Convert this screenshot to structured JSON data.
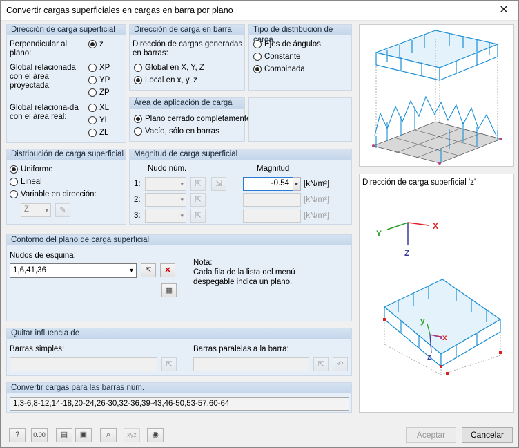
{
  "window": {
    "title": "Convertir cargas superficiales en cargas en barra por plano",
    "close": "✕"
  },
  "dir_surface": {
    "header": "Dirección de carga superficial",
    "perp_label": "Perpendicular al plano:",
    "global_proj_label": "Global relacionada con el área proyectada:",
    "global_real_label": "Global relaciona-da con el área real:",
    "opts": {
      "z": "z",
      "xp": "XP",
      "yp": "YP",
      "zp": "ZP",
      "xl": "XL",
      "yl": "YL",
      "zl": "ZL"
    },
    "selected": "z"
  },
  "dir_bar": {
    "header": "Dirección de carga en barra",
    "desc": "Dirección de cargas generadas en barras:",
    "global": "Global en X, Y, Z",
    "local": "Local en x, y, z",
    "selected": "local"
  },
  "dist_type": {
    "header": "Tipo de distribución de carga",
    "ejes": "Ejes de ángulos",
    "constante": "Constante",
    "combinada": "Combinada",
    "selected": "combinada"
  },
  "area": {
    "header": "Área de aplicación de carga",
    "cerrado": "Plano cerrado completamente",
    "vacio": "Vacío, sólo en barras",
    "selected": "cerrado"
  },
  "dist_surface": {
    "header": "Distribución de carga superficial",
    "uniforme": "Uniforme",
    "lineal": "Lineal",
    "variable": "Variable en dirección:",
    "dir_value": "Z",
    "selected": "uniforme"
  },
  "magnitude": {
    "header": "Magnitud de carga superficial",
    "col_node": "Nudo núm.",
    "col_mag": "Magnitud",
    "rows": [
      {
        "label": "1:",
        "value": "-0.54",
        "unit": "[kN/m²]"
      },
      {
        "label": "2:",
        "value": "",
        "unit": "[kN/m²]"
      },
      {
        "label": "3:",
        "value": "",
        "unit": "[kN/m²]"
      }
    ]
  },
  "contour": {
    "header": "Contorno del plano de carga superficial",
    "corner_label": "Nudos de esquina:",
    "corner_value": "1,6,41,36",
    "note_title": "Nota:",
    "note_text1": "Cada fila de la lista del menú",
    "note_text2": "despegable indica un plano."
  },
  "remove": {
    "header": "Quitar influencia de",
    "simple_label": "Barras simples:",
    "parallel_label": "Barras paralelas a la barra:"
  },
  "convert": {
    "header": "Convertir cargas para las barras núm.",
    "value": "1,3-6,8-12,14-18,20-24,26-30,32-36,39-43,46-50,53-57,60-64"
  },
  "preview": {
    "caption": "Dirección de carga superficial 'z'",
    "axis_x": "X",
    "axis_y": "Y",
    "axis_z": "Z",
    "local_y": "y",
    "local_x": "x",
    "local_z": "z"
  },
  "footer": {
    "accept": "Aceptar",
    "cancel": "Cancelar"
  },
  "colors": {
    "accent": "#1a8fd6",
    "red": "#e02020",
    "green": "#2aa02a",
    "navy": "#3a3a9a"
  }
}
